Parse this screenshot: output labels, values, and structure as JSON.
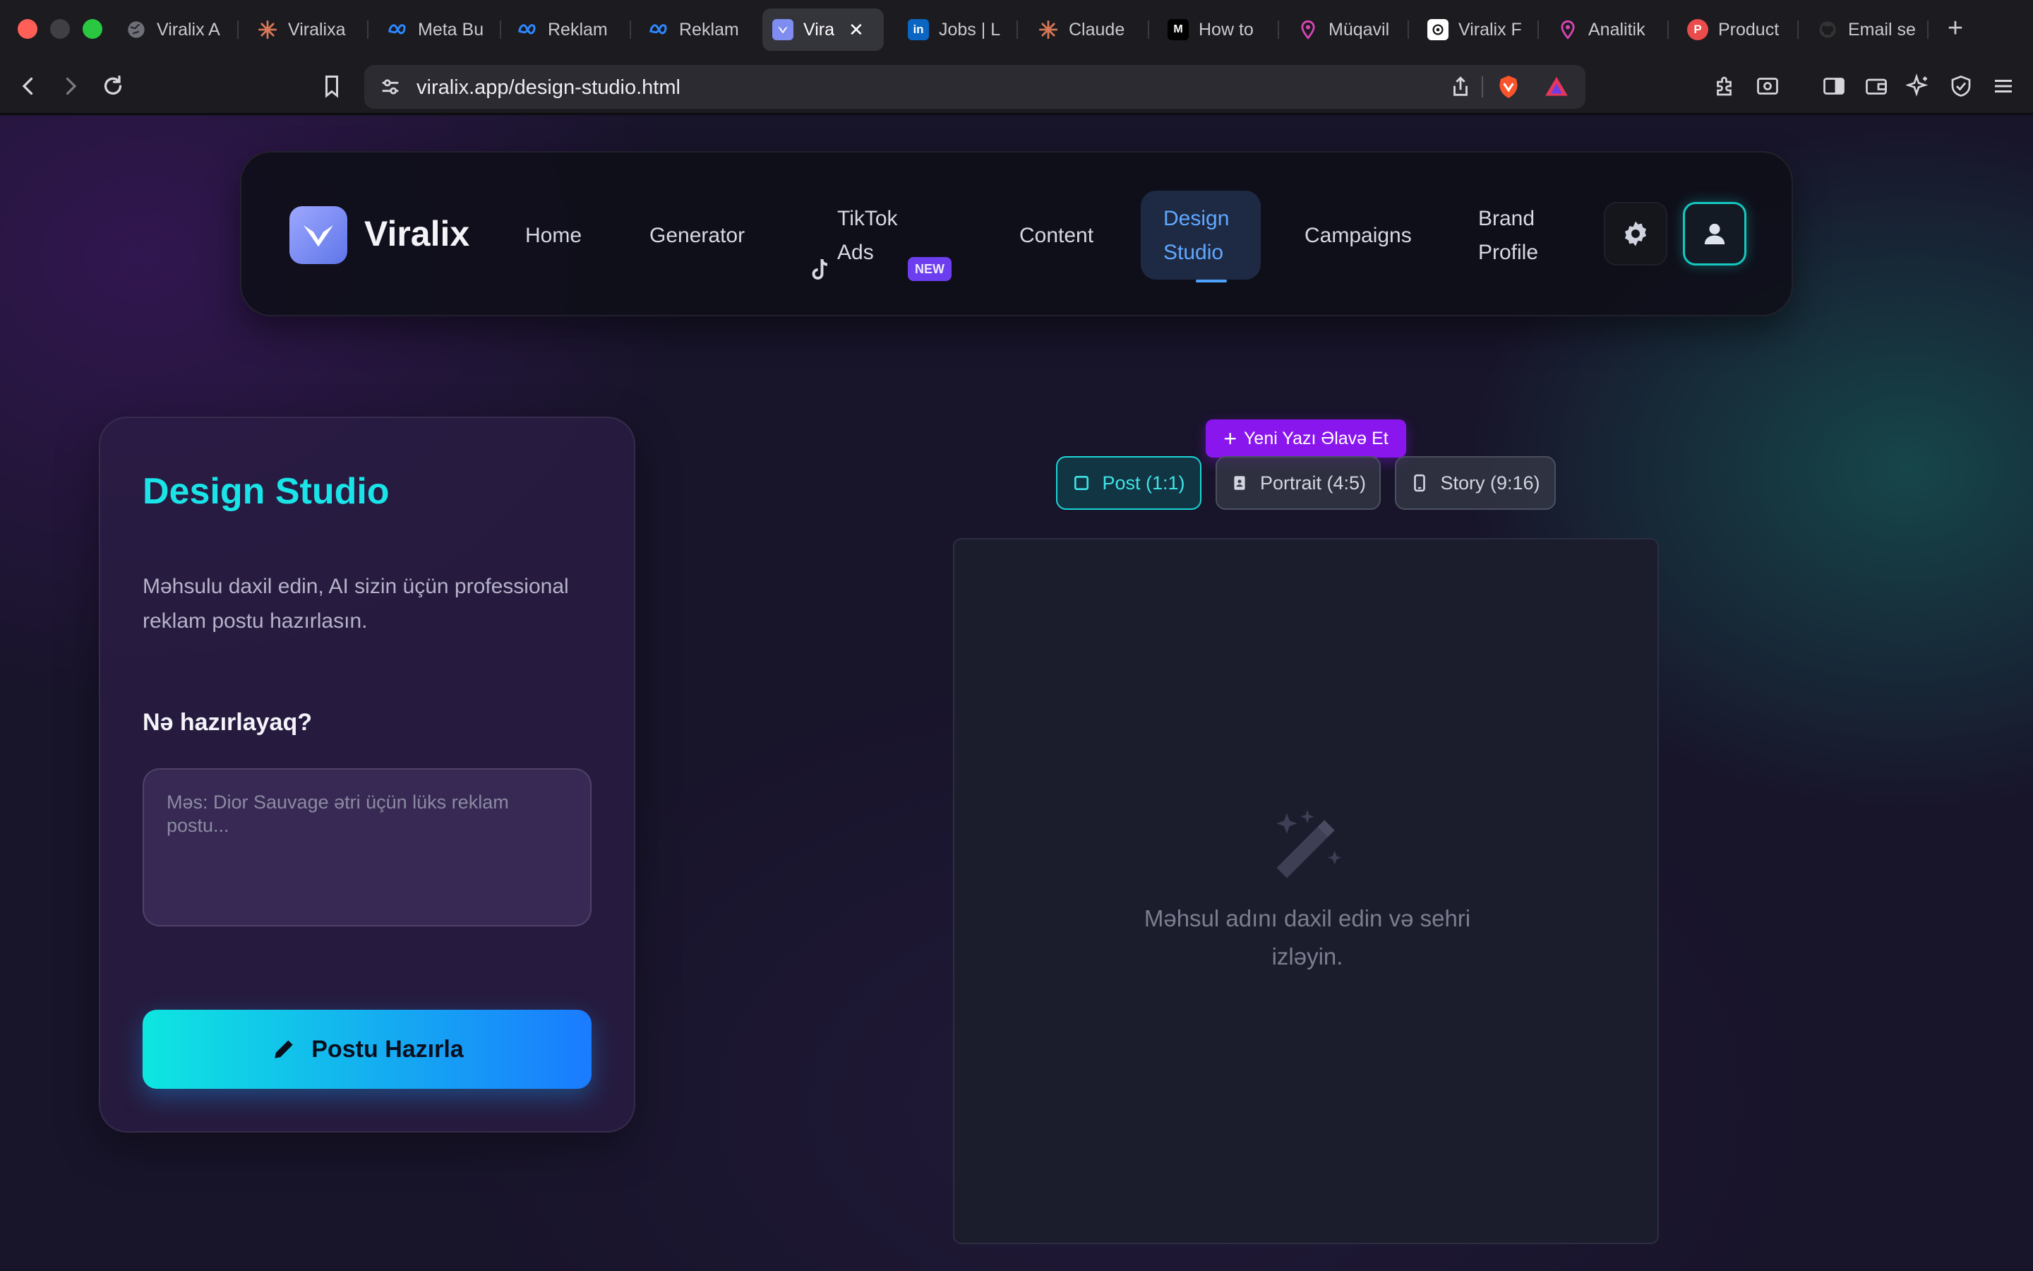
{
  "browser": {
    "tabs": [
      {
        "title": "Viralix A",
        "favicon": "globe-icon",
        "color": "#7a7a84"
      },
      {
        "title": "Viralixa",
        "favicon": "claude-icon",
        "color": "#d97757"
      },
      {
        "title": "Meta Bu",
        "favicon": "meta-icon",
        "color": "#1877f2"
      },
      {
        "title": "Reklam",
        "favicon": "meta-icon",
        "color": "#1877f2"
      },
      {
        "title": "Reklam",
        "favicon": "meta-icon",
        "color": "#1877f2"
      },
      {
        "title": "Vira",
        "favicon": "viralix-icon",
        "color": "#7f8cf0",
        "active": true
      },
      {
        "title": "Jobs | L",
        "favicon": "linkedin-icon",
        "color": "#0a66c2"
      },
      {
        "title": "Claude",
        "favicon": "claude-icon",
        "color": "#d97757"
      },
      {
        "title": "How to",
        "favicon": "medium-icon",
        "color": "#000000"
      },
      {
        "title": "Müqavil",
        "favicon": "pin-icon",
        "color": "#d946b4"
      },
      {
        "title": "Viralix F",
        "favicon": "openai-icon",
        "color": "#ffffff"
      },
      {
        "title": "Analitik",
        "favicon": "pin-icon",
        "color": "#d946b4"
      },
      {
        "title": "Product",
        "favicon": "producthunt-icon",
        "color": "#ea4c4c"
      },
      {
        "title": "Email se",
        "favicon": "github-icon",
        "color": "#333333"
      }
    ],
    "url": "viralix.app/design-studio.html"
  },
  "nav": {
    "brand": "Viralix",
    "links": {
      "home": "Home",
      "generator": "Generator",
      "tiktok_line1": "TikTok",
      "tiktok_line2": "Ads",
      "tiktok_badge": "NEW",
      "content": "Content",
      "design_line1": "Design",
      "design_line2": "Studio",
      "campaigns": "Campaigns",
      "brand_line1": "Brand",
      "brand_line2": "Profile"
    },
    "active": "Design Studio"
  },
  "panel": {
    "title": "Design Studio",
    "description": "Məhsulu daxil edin, AI sizin üçün professional reklam postu hazırlasın.",
    "prompt_label": "Nə hazırlayaq?",
    "prompt_placeholder": "Məs: Dior Sauvage ətri üçün lüks reklam postu...",
    "prompt_value": "",
    "generate_label": "Postu Hazırla"
  },
  "canvas": {
    "add_text_label": "Yeni Yazı Əlavə Et",
    "ratios": [
      {
        "label": "Post (1:1)",
        "icon": "square-icon",
        "active": true
      },
      {
        "label": "Portrait (4:5)",
        "icon": "portrait-icon",
        "active": false
      },
      {
        "label": "Story (9:16)",
        "icon": "phone-icon",
        "active": false
      }
    ],
    "empty_message": "Məhsul adını daxil edin və sehri izləyin."
  },
  "colors": {
    "accent_cyan": "#19e4e8",
    "accent_blue": "#1a7bff",
    "accent_purple": "#8a16ee",
    "nav_active": "#5fa8ff"
  }
}
